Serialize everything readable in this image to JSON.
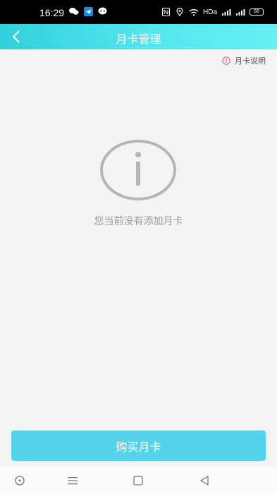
{
  "status": {
    "time": "16:29",
    "network_label": "HDa",
    "battery": "66"
  },
  "header": {
    "title": "月卡管理"
  },
  "help_link": {
    "label": "月卡说明"
  },
  "empty_state": {
    "message": "您当前没有添加月卡"
  },
  "actions": {
    "buy_label": "购买月卡"
  },
  "colors": {
    "header_gradient_start": "#33d0da",
    "header_gradient_end": "#66f0f3",
    "primary_button": "#55d3ea",
    "empty_icon": "#b5b5b5",
    "help_icon": "#e05a5a"
  },
  "icons": {
    "back": "chevron-left-icon",
    "help": "info-circle-icon",
    "empty": "info-icon",
    "nav_home": "circle-dot-icon",
    "nav_menu": "menu-icon",
    "nav_recent": "square-icon",
    "nav_back": "triangle-left-icon"
  }
}
